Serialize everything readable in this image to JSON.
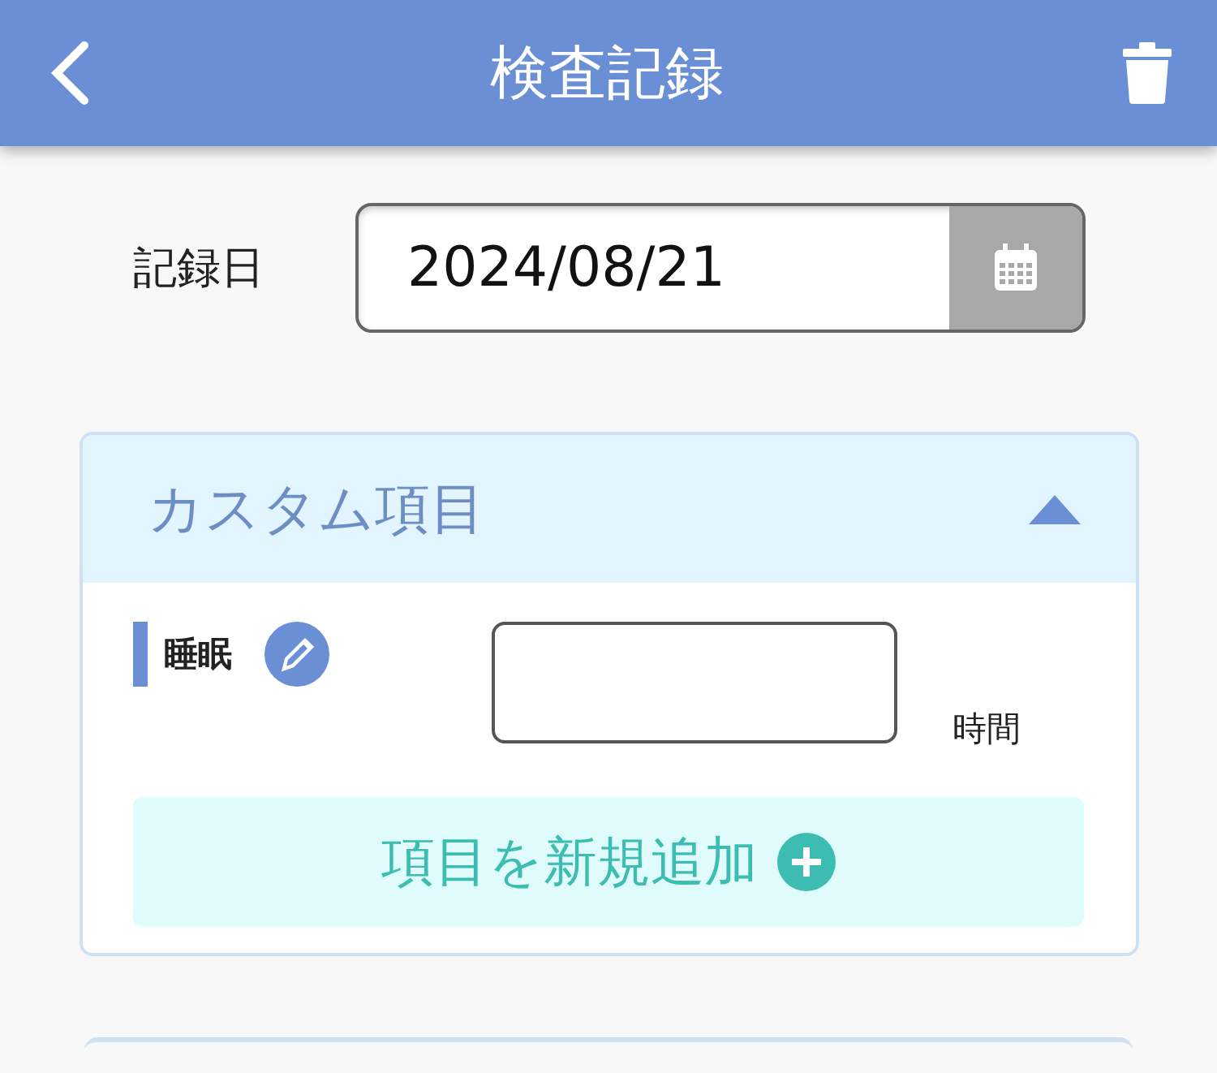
{
  "header": {
    "title": "検査記録"
  },
  "record_date": {
    "label": "記録日",
    "value": "2024/08/21"
  },
  "custom_section": {
    "title": "カスタム項目",
    "expanded": true,
    "items": [
      {
        "label": "睡眠",
        "value": "",
        "unit": "時間"
      }
    ],
    "add_button": "項目を新規追加"
  }
}
